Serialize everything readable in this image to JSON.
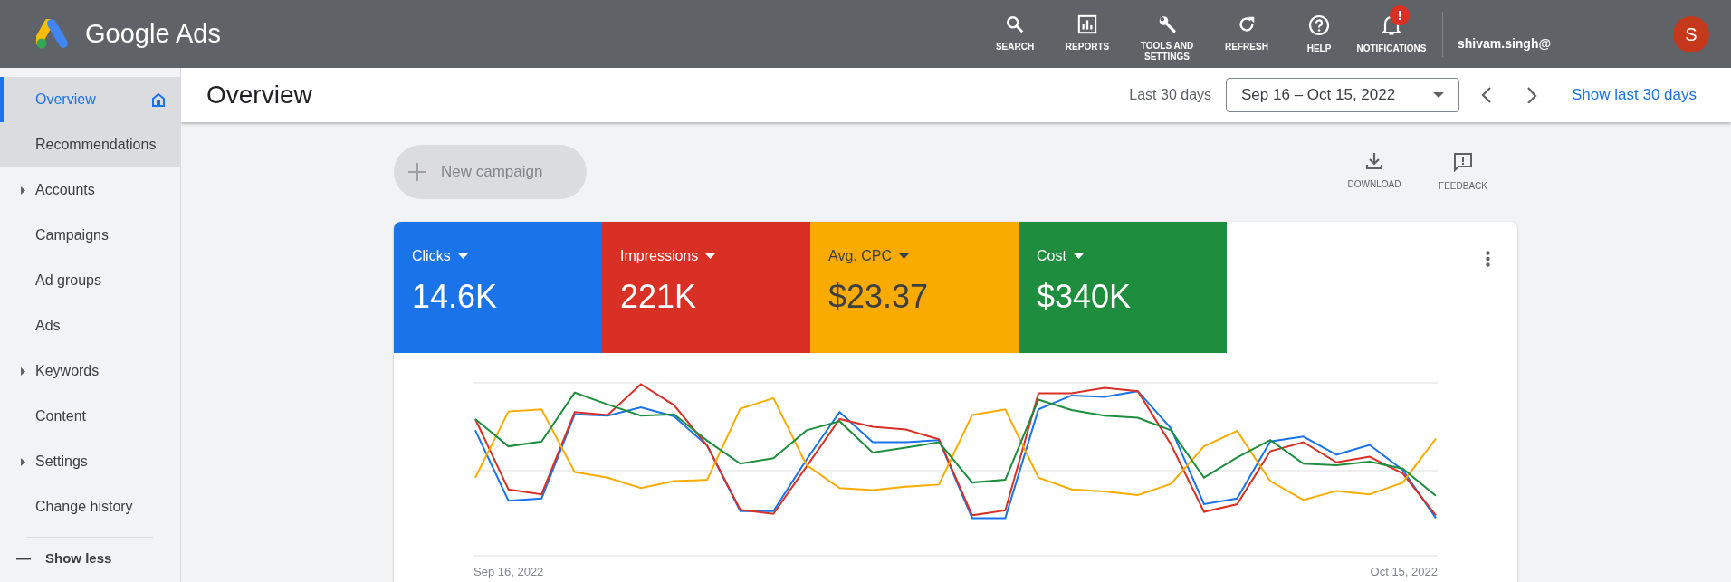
{
  "header": {
    "product": "Google Ads",
    "tools": [
      {
        "kind": "search",
        "label": "SEARCH"
      },
      {
        "kind": "reports",
        "label": "REPORTS"
      },
      {
        "kind": "tools",
        "label": "TOOLS AND SETTINGS"
      },
      {
        "kind": "refresh",
        "label": "REFRESH"
      },
      {
        "kind": "help",
        "label": "HELP"
      },
      {
        "kind": "notifications",
        "label": "NOTIFICATIONS",
        "badge": "!"
      }
    ],
    "account": {
      "email": "shivam.singh@",
      "avatar": "S"
    }
  },
  "sidebar": {
    "items": [
      {
        "label": "Overview",
        "selected": true,
        "hovered": false,
        "expandable": false
      },
      {
        "label": "Recommendations",
        "selected": false,
        "hovered": true,
        "expandable": false
      },
      {
        "label": "Accounts",
        "selected": false,
        "hovered": false,
        "expandable": true
      },
      {
        "label": "Campaigns",
        "selected": false,
        "hovered": false,
        "expandable": false
      },
      {
        "label": "Ad groups",
        "selected": false,
        "hovered": false,
        "expandable": false
      },
      {
        "label": "Ads",
        "selected": false,
        "hovered": false,
        "expandable": false
      },
      {
        "label": "Keywords",
        "selected": false,
        "hovered": false,
        "expandable": true
      },
      {
        "label": "Content",
        "selected": false,
        "hovered": false,
        "expandable": false
      },
      {
        "label": "Settings",
        "selected": false,
        "hovered": false,
        "expandable": true
      },
      {
        "label": "Change history",
        "selected": false,
        "hovered": false,
        "expandable": false
      }
    ],
    "toggle": "Show less"
  },
  "page": {
    "title": "Overview",
    "range_label": "Last 30 days",
    "date_range": "Sep 16 – Oct 15, 2022",
    "link": "Show last 30 days"
  },
  "actions": {
    "new_campaign": "New campaign",
    "download": "DOWNLOAD",
    "feedback": "FEEDBACK"
  },
  "metrics": [
    {
      "label": "Clicks",
      "value": "14.6K",
      "color": "#1a73e8"
    },
    {
      "label": "Impressions",
      "value": "221K",
      "color": "#d93025"
    },
    {
      "label": "Avg. CPC",
      "value": "$23.37",
      "color": "#f9ab00"
    },
    {
      "label": "Cost",
      "value": "$340K",
      "color": "#1e8e3e"
    }
  ],
  "chart": {
    "x_start": "Sep 16, 2022",
    "x_end": "Oct 15, 2022"
  }
}
